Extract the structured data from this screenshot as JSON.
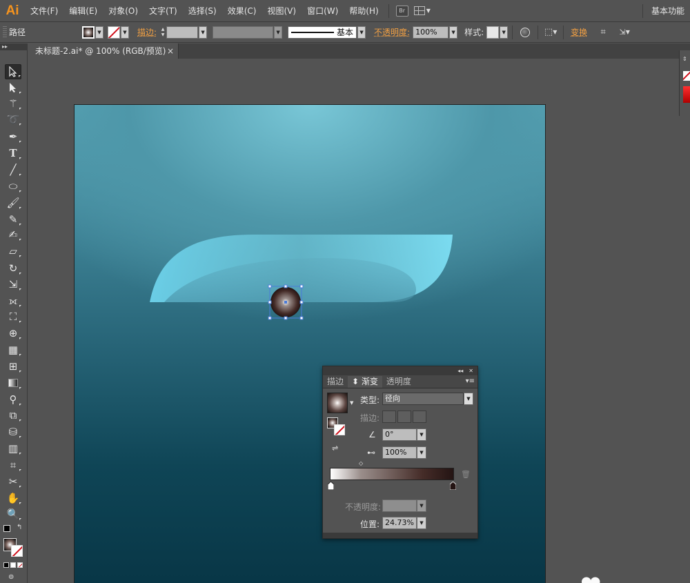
{
  "app": {
    "logo": "Ai",
    "workspace": "基本功能"
  },
  "menu": [
    "文件(F)",
    "编辑(E)",
    "对象(O)",
    "文字(T)",
    "选择(S)",
    "效果(C)",
    "视图(V)",
    "窗口(W)",
    "帮助(H)"
  ],
  "menubar_icons": {
    "bridge": "Br"
  },
  "control_bar": {
    "object_type": "路径",
    "stroke_label": "描边:",
    "stroke_style": "基本",
    "opacity_label": "不透明度:",
    "opacity_value": "100%",
    "style_label": "样式:",
    "transform_label": "变换"
  },
  "document": {
    "tab_title": "未标题-2.ai* @ 100% (RGB/预览)",
    "close": "×"
  },
  "tools": [
    "selection-tool",
    "direct-selection-tool",
    "magic-wand-tool",
    "lasso-tool",
    "pen-tool",
    "type-tool",
    "line-tool",
    "ellipse-tool",
    "paintbrush-tool",
    "pencil-tool",
    "blob-brush-tool",
    "eraser-tool",
    "rotate-tool",
    "scale-tool",
    "width-tool",
    "free-transform-tool",
    "shape-builder-tool",
    "perspective-grid-tool",
    "mesh-tool",
    "gradient-tool",
    "eyedropper-tool",
    "blend-tool",
    "symbol-sprayer-tool",
    "column-graph-tool",
    "artboard-tool",
    "slice-tool",
    "hand-tool",
    "zoom-tool"
  ],
  "gradient_panel": {
    "tabs": [
      "描边",
      "渐变",
      "透明度"
    ],
    "active_tab": "渐变",
    "type_label": "类型:",
    "type_value": "径向",
    "stroke_label": "描边:",
    "angle_value": "0°",
    "aspect_value": "100%",
    "opacity_label": "不透明度:",
    "location_label": "位置:",
    "location_value": "24.73%",
    "gradient_stops": [
      {
        "color": "#ffffff",
        "position": 0
      },
      {
        "color": "#241413",
        "position": 100
      }
    ],
    "midpoint_marker": 24.73
  },
  "colors": {
    "accent_orange": "#f7941d",
    "none_red": "#d0101b",
    "selection_blue": "#4a7bd9"
  },
  "watermark": "●●"
}
